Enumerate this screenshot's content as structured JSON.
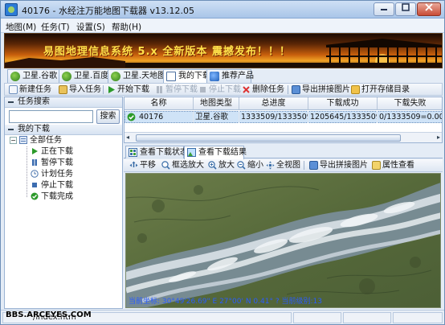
{
  "window": {
    "title": "40176 - 水经注万能地图下载器 v13.12.05",
    "minimize": "0",
    "maximize": "1",
    "close": "r"
  },
  "menu": [
    "地图(M)",
    "任务(T)",
    "设置(S)",
    "帮助(H)"
  ],
  "banner": {
    "text": "易图地理信息系统 5.x 全新版本 震撼发布！！！"
  },
  "map_tabs": [
    "卫星.谷歌",
    "卫星.百度",
    "卫星.天地图",
    "我的下载",
    "推荐产品"
  ],
  "toolbar": {
    "new_task": "新建任务",
    "import_task": "导入任务",
    "start": "开始下载",
    "pause": "暂停下载",
    "stop": "停止下载",
    "delete": "删除任务",
    "export_mosaic": "导出拼接图片",
    "open_dir": "打开存储目录"
  },
  "left": {
    "search_head": "任务搜索",
    "search_placeholder": "",
    "search_button": "搜索",
    "my_downloads_head": "我的下载",
    "tree_root": "全部任务",
    "tree_items": [
      "正在下载",
      "暂停下载",
      "计划任务",
      "停止下载",
      "下载完成"
    ]
  },
  "grid": {
    "headers": [
      "名称",
      "地图类型",
      "总进度",
      "下载成功",
      "下载失败"
    ],
    "rows": [
      [
        "40176",
        "卫星.谷歌",
        "1333509/1333509...",
        "1205645/1333509...",
        "0/1333509=0.00%"
      ]
    ]
  },
  "sub_tabs": [
    "查看下载状态",
    "查看下载结果"
  ],
  "map_toolbar": [
    "平移",
    "框选放大",
    "放大",
    "缩小",
    "全视图",
    "导出拼接图片",
    "属性查看"
  ],
  "map": {
    "coords": "当前坐标:  30°49'26.69\" E  27°00'  N  0.41°  ?  当前级别:13"
  },
  "status": {
    "url": "/index.htm"
  },
  "watermark": "BBS.ARCEYES.COM",
  "colors": {
    "accent": "#2c7bd6",
    "selection": "#cfe3f7",
    "banner_text": "#ffe24a",
    "coord_text": "#2a5cff"
  }
}
